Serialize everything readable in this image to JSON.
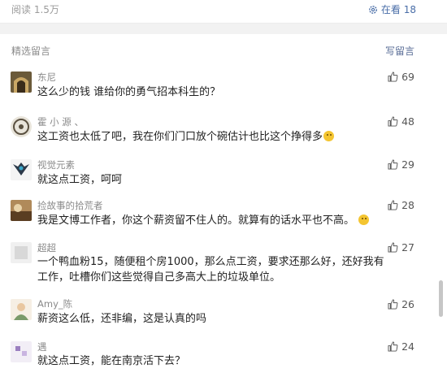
{
  "header": {
    "reads": "阅读 1.5万",
    "watching_label": "在看 18"
  },
  "section": {
    "title": "精选留言",
    "write_label": "写留言"
  },
  "comments": [
    {
      "nick": "东尼",
      "text": "这么少的钱 谁给你的勇气招本科生的？",
      "likes": "69"
    },
    {
      "nick": "霍 小 源 、",
      "text": "这工资也太低了吧，我在你们门口放个碗估计也比这个挣得多",
      "likes": "48"
    },
    {
      "nick": "视觉元素",
      "text": "就这点工资，呵呵",
      "likes": "29"
    },
    {
      "nick": "捡故事的拾荒者",
      "text": "我是文博工作者，你这个薪资留不住人的。就算有的话水平也不高。",
      "likes": "28"
    },
    {
      "nick": "超超",
      "text": "一个鸭血粉15，随便租个房1000，那么点工资，要求还那么好，还好我有工作，吐槽你们这些觉得自己多高大上的垃圾单位。",
      "likes": "27"
    },
    {
      "nick": "Amy_陈",
      "text": "薪资这么低，还非编，这是认真的吗",
      "likes": "26"
    },
    {
      "nick": "遇",
      "text": "就这点工资，能在南京活下去？",
      "likes": "24"
    }
  ],
  "icons": {
    "watching": "gear-icon",
    "like": "thumbs-up-icon"
  },
  "colors": {
    "link": "#576b95",
    "muted": "#8a8a8a"
  }
}
